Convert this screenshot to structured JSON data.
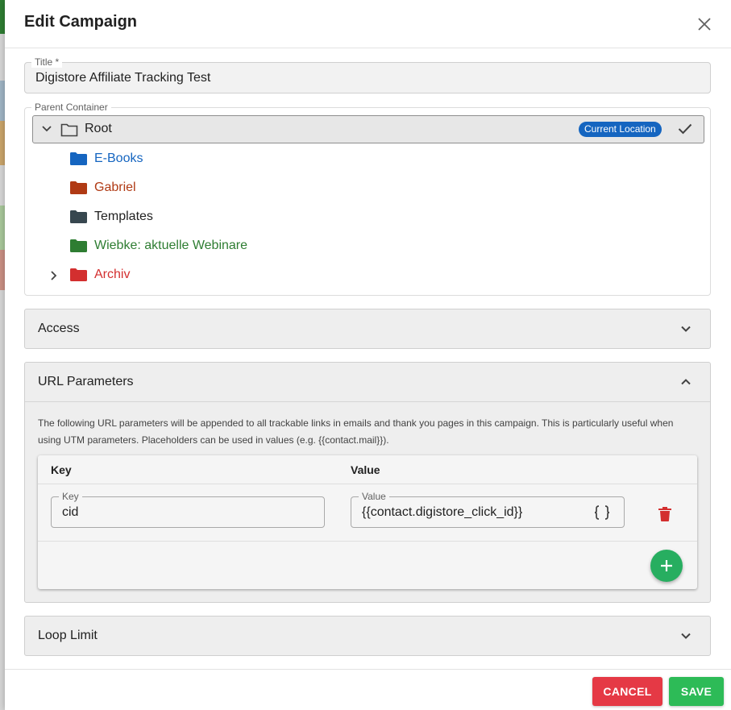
{
  "colors": {
    "e_books": "#1565c0",
    "gabriel": "#b03a14",
    "templates": "#37474f",
    "wiebke": "#2e7d32",
    "archiv": "#d32f2f",
    "badge": "#1565c0",
    "cancel": "#e53945",
    "save": "#2dbb57",
    "add": "#27ae60",
    "delete": "#d32f2f"
  },
  "dialog": {
    "title": "Edit Campaign",
    "close_icon": "close-icon"
  },
  "title_field": {
    "label": "Title *",
    "value": "Digistore Affiliate Tracking Test"
  },
  "parent_container": {
    "label": "Parent Container",
    "root": {
      "label": "Root",
      "badge": "Current Location",
      "icons": [
        "chevron-down-icon",
        "folder-outline-icon",
        "check-icon"
      ]
    },
    "items": [
      {
        "label": "E-Books",
        "color": "#1565c0",
        "icon": "folder-icon"
      },
      {
        "label": "Gabriel",
        "color": "#b03a14",
        "icon": "folder-icon"
      },
      {
        "label": "Templates",
        "color": "#37474f",
        "icon": "folder-icon"
      },
      {
        "label": "Wiebke: aktuelle Webinare",
        "color": "#2e7d32",
        "icon": "folder-icon"
      },
      {
        "label": "Archiv",
        "color": "#d32f2f",
        "icon": "folder-icon",
        "expandable": true
      }
    ]
  },
  "access": {
    "label": "Access",
    "icon": "chevron-down-icon"
  },
  "url_parameters": {
    "label": "URL Parameters",
    "icon": "chevron-up-icon",
    "description": "The following URL parameters will be appended to all trackable links in emails and thank you pages in this campaign. This is particularly useful when using UTM parameters. Placeholders can be used in values (e.g. {{contact.mail}}).",
    "columns": {
      "key": "Key",
      "value": "Value"
    },
    "rows": [
      {
        "key_label": "Key",
        "key": "cid",
        "value_label": "Value",
        "value": "{{contact.digistore_click_id}}"
      }
    ],
    "icons": [
      "code-braces-icon",
      "delete-icon",
      "plus-icon"
    ]
  },
  "loop_limit": {
    "label": "Loop Limit",
    "icon": "chevron-down-icon"
  },
  "footer": {
    "cancel_label": "CANCEL",
    "save_label": "SAVE"
  }
}
